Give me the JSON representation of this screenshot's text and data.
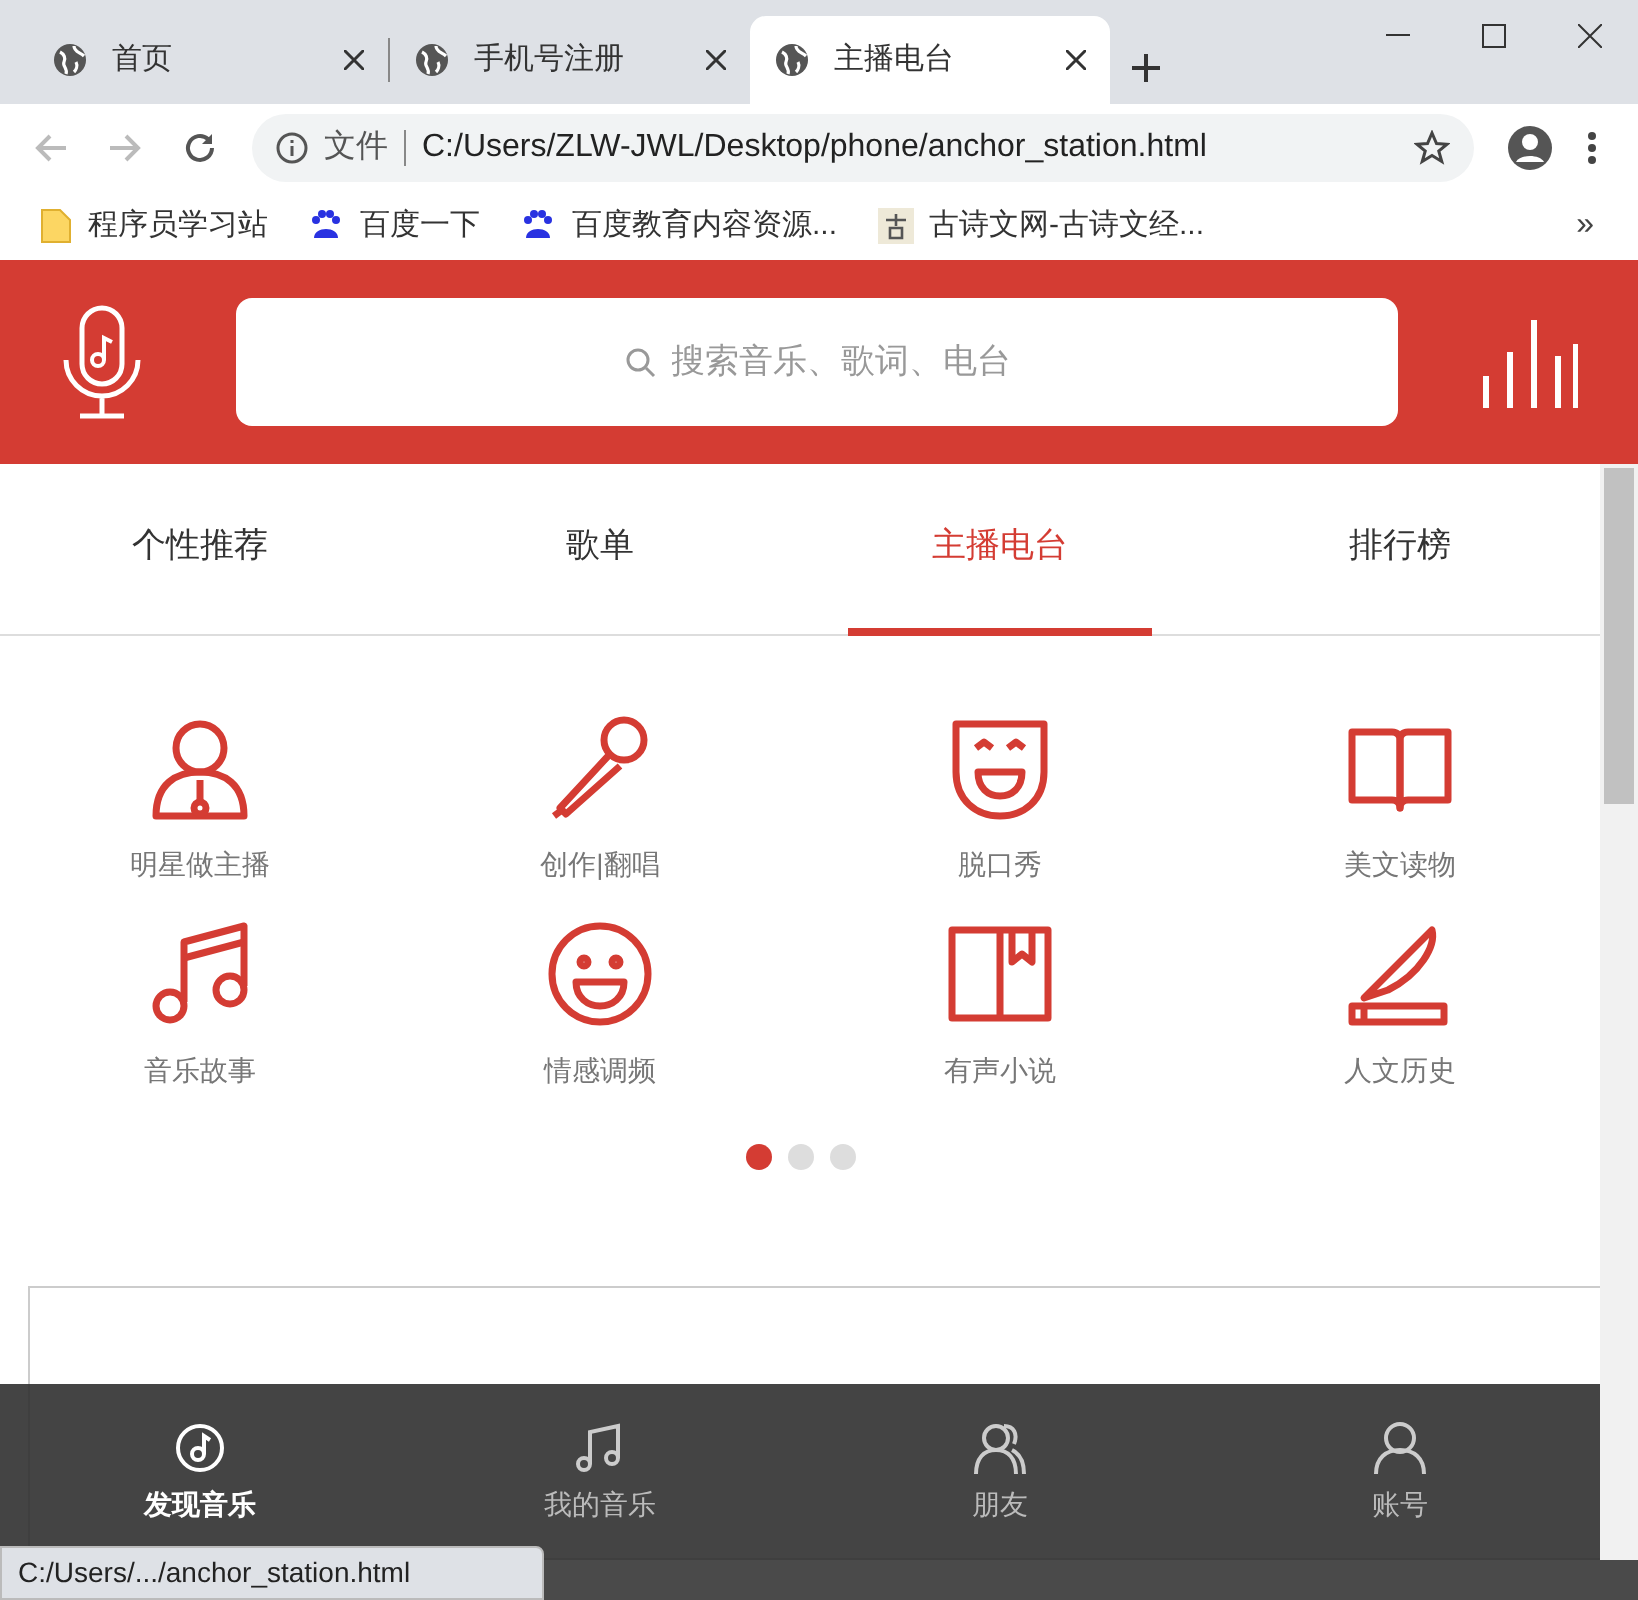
{
  "browser": {
    "tabs": [
      {
        "title": "首页",
        "selected": false
      },
      {
        "title": "手机号注册",
        "selected": false
      },
      {
        "title": "主播电台",
        "selected": true
      }
    ],
    "address": {
      "label": "文件",
      "url": "C:/Users/ZLW-JWL/Desktop/phone/anchor_station.html"
    },
    "bookmarks": [
      "程序员学习站",
      "百度一下",
      "百度教育内容资源...",
      "古诗文网-古诗文经..."
    ],
    "bookmarks_more": "»",
    "status_url": "C:/Users/.../anchor_station.html"
  },
  "header": {
    "search_placeholder": "搜索音乐、歌词、电台"
  },
  "nav_tabs": [
    {
      "label": "个性推荐",
      "selected": false
    },
    {
      "label": "歌单",
      "selected": false
    },
    {
      "label": "主播电台",
      "selected": true
    },
    {
      "label": "排行榜",
      "selected": false
    }
  ],
  "categories": [
    "明星做主播",
    "创作|翻唱",
    "脱口秀",
    "美文读物",
    "音乐故事",
    "情感调频",
    "有声小说",
    "人文历史"
  ],
  "carousel_dots": [
    {
      "selected": true
    },
    {
      "selected": false
    },
    {
      "selected": false
    }
  ],
  "bottom_nav": [
    {
      "label": "发现音乐",
      "selected": true
    },
    {
      "label": "我的音乐",
      "selected": false
    },
    {
      "label": "朋友",
      "selected": false
    },
    {
      "label": "账号",
      "selected": false
    }
  ]
}
